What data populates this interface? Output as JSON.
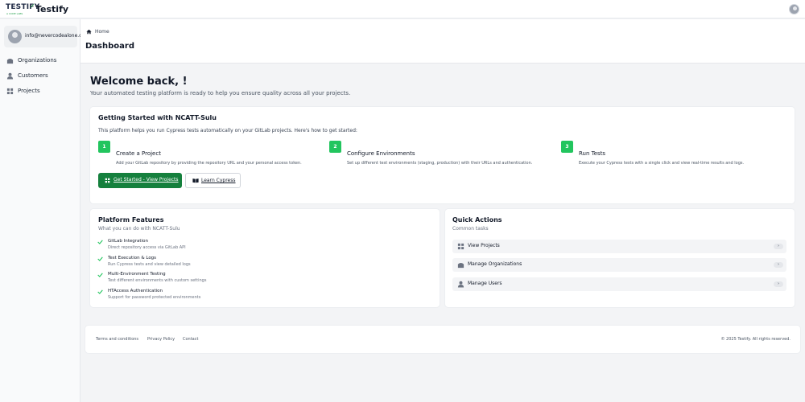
{
  "brand": {
    "logo_text": "TESTIFY",
    "logo_tagline": "A CODE LABS",
    "app_name": "Testify"
  },
  "user": {
    "email": "info@nevercodealone.de"
  },
  "sidebar": {
    "items": [
      {
        "label": "Organizations",
        "icon": "building-icon"
      },
      {
        "label": "Customers",
        "icon": "person-icon"
      },
      {
        "label": "Projects",
        "icon": "grid-icon"
      }
    ]
  },
  "breadcrumb": {
    "home": "Home"
  },
  "page": {
    "title": "Dashboard"
  },
  "welcome": {
    "title": "Welcome back, !",
    "subtitle": "Your automated testing platform is ready to help you ensure quality across all your projects."
  },
  "getting_started": {
    "title": "Getting Started with NCATT-Sulu",
    "intro": "This platform helps you run Cypress tests automatically on your GitLab projects. Here's how to get started:",
    "steps": [
      {
        "number": "1",
        "title": "Create a Project",
        "desc": "Add your GitLab repository by providing the repository URL and your personal access token."
      },
      {
        "number": "2",
        "title": "Configure Environments",
        "desc": "Set up different test environments (staging, production) with their URLs and authentication."
      },
      {
        "number": "3",
        "title": "Run Tests",
        "desc": "Execute your Cypress tests with a single click and view real-time results and logs."
      }
    ],
    "primary_button": "Get Started - View Projects",
    "secondary_button": "Learn Cypress"
  },
  "features": {
    "title": "Platform Features",
    "subtitle": "What you can do with NCATT-Sulu",
    "items": [
      {
        "title": "GitLab Integration",
        "desc": "Direct repository access via GitLab API"
      },
      {
        "title": "Test Execution & Logs",
        "desc": "Run Cypress tests and view detailed logs"
      },
      {
        "title": "Multi-Environment Testing",
        "desc": "Test different environments with custom settings"
      },
      {
        "title": "HTAccess Authentication",
        "desc": "Support for password protected environments"
      }
    ]
  },
  "quick_actions": {
    "title": "Quick Actions",
    "subtitle": "Common tasks",
    "items": [
      {
        "label": "View Projects",
        "icon": "grid-icon"
      },
      {
        "label": "Manage Organizations",
        "icon": "building-icon"
      },
      {
        "label": "Manage Users",
        "icon": "person-icon"
      }
    ],
    "chevron": "›"
  },
  "footer": {
    "links": [
      "Terms and conditions",
      "Privacy Policy",
      "Contact"
    ],
    "copyright": "© 2025 Testify. All rights reserved."
  },
  "colors": {
    "accent_green": "#22c55e",
    "primary_button": "#15803d",
    "background": "#f3f4f6"
  }
}
